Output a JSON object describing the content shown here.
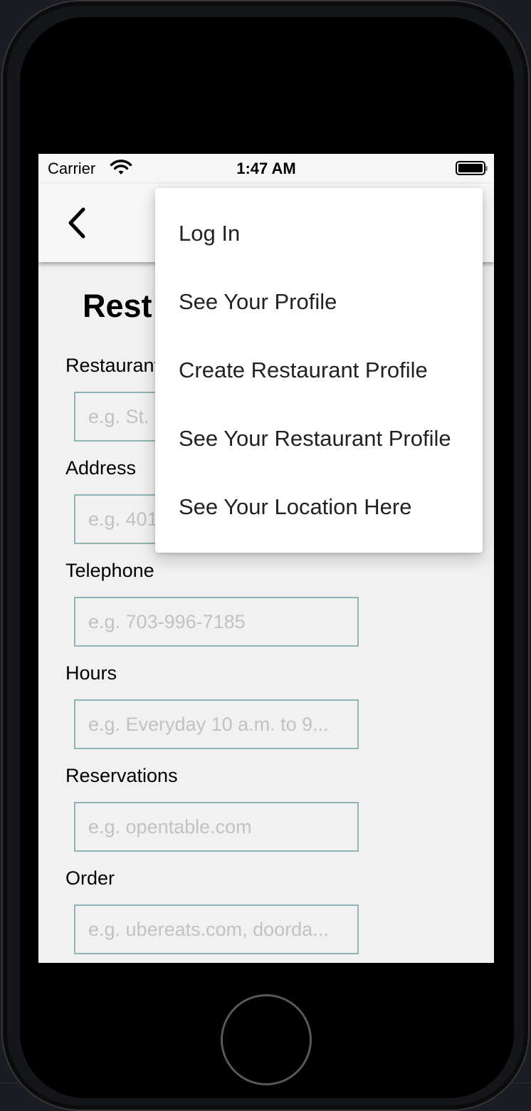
{
  "status_bar": {
    "carrier": "Carrier",
    "time": "1:47 AM"
  },
  "icons": {
    "wifi": "wifi-icon",
    "battery": "battery-icon",
    "back": "chevron-left-icon"
  },
  "page": {
    "title": "Rest"
  },
  "form": {
    "fields": [
      {
        "label": "Restaurant",
        "placeholder": "e.g. St."
      },
      {
        "label": "Address",
        "placeholder": "e.g. 401"
      },
      {
        "label": "Telephone",
        "placeholder": "e.g. 703-996-7185"
      },
      {
        "label": "Hours",
        "placeholder": "e.g. Everyday 10 a.m. to 9..."
      },
      {
        "label": "Reservations",
        "placeholder": "e.g. opentable.com"
      },
      {
        "label": "Order",
        "placeholder": "e.g. ubereats.com, doorda..."
      }
    ]
  },
  "menu": {
    "items": [
      {
        "label": "Log In"
      },
      {
        "label": "See Your Profile"
      },
      {
        "label": "Create Restaurant Profile"
      },
      {
        "label": "See Your Restaurant Profile"
      },
      {
        "label": "See Your Location Here"
      }
    ]
  },
  "colors": {
    "input_border": "#8fb4b3",
    "screen_background": "#f1f1f1"
  }
}
